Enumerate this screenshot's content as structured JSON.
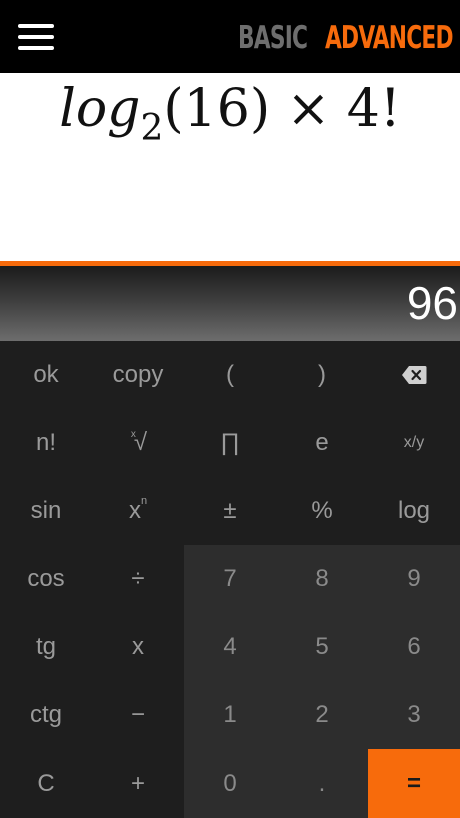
{
  "header": {
    "tab_basic": "BASIC",
    "tab_advanced": "ADVANCED"
  },
  "expression": {
    "func": "log",
    "base": "2",
    "argument": "(16)",
    "operator": "×",
    "number": "4!"
  },
  "result": "96",
  "keys": {
    "ok": "ok",
    "copy": "copy",
    "open_paren": "(",
    "close_paren": ")",
    "factorial": "n!",
    "root_index": "x",
    "root_sign": "√",
    "pi": "∏",
    "e": "e",
    "fraction": "x/y",
    "sin": "sin",
    "power_base": "x",
    "power_exp": "n",
    "plus_minus": "±",
    "percent": "%",
    "log": "log",
    "cos": "cos",
    "divide": "÷",
    "seven": "7",
    "eight": "8",
    "nine": "9",
    "tg": "tg",
    "multiply": "x",
    "four": "4",
    "five": "5",
    "six": "6",
    "ctg": "ctg",
    "minus": "−",
    "one": "1",
    "two": "2",
    "three": "3",
    "clear": "C",
    "plus": "+",
    "zero": "0",
    "dot": ".",
    "equals": "="
  },
  "colors": {
    "accent": "#f76b0c",
    "header_bg": "#000000",
    "keypad_bg": "#1e1e1e",
    "numpad_bg": "#2d2d2d"
  },
  "icons": {
    "menu": "hamburger-menu-icon",
    "backspace": "backspace-icon"
  }
}
